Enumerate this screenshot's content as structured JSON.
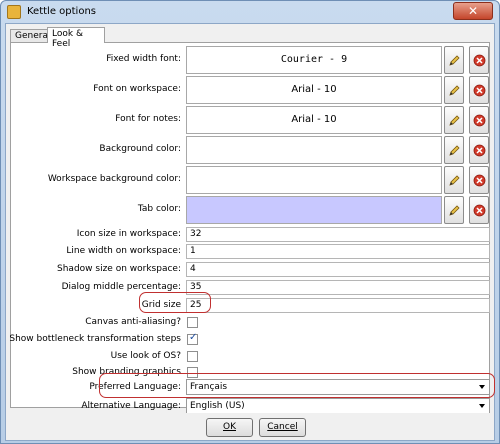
{
  "window": {
    "title": "Kettle options",
    "close_glyph": "✕"
  },
  "tabs": [
    {
      "label": "General",
      "active": false
    },
    {
      "label": "Look & Feel",
      "active": true
    }
  ],
  "fonts": {
    "fixed_width": {
      "label": "Fixed width font:",
      "value": "Courier - 9"
    },
    "workspace": {
      "label": "Font on workspace:",
      "value": "Arial - 10"
    },
    "notes": {
      "label": "Font for notes:",
      "value": "Arial - 10"
    }
  },
  "colors": {
    "background": {
      "label": "Background color:",
      "value": "#ffffff"
    },
    "workspace_background": {
      "label": "Workspace background color:",
      "value": "#ffffff"
    },
    "tab": {
      "label": "Tab color:",
      "value": "#c8c8ff"
    }
  },
  "fields": {
    "icon_size": {
      "label": "Icon size in workspace:",
      "value": "32"
    },
    "line_width": {
      "label": "Line width on workspace:",
      "value": "1"
    },
    "shadow_size": {
      "label": "Shadow size on workspace:",
      "value": "4"
    },
    "dialog_middle": {
      "label": "Dialog middle percentage:",
      "value": "35"
    },
    "grid_size": {
      "label": "Grid size",
      "value": "25"
    }
  },
  "checks": {
    "anti_aliasing": {
      "label": "Canvas anti-aliasing?",
      "checked": false
    },
    "bottleneck": {
      "label": "Show bottleneck transformation steps",
      "checked": true
    },
    "look_of_os": {
      "label": "Use look of OS?",
      "checked": false
    },
    "branding": {
      "label": "Show branding graphics",
      "checked": false
    }
  },
  "languages": {
    "preferred": {
      "label": "Preferred Language:",
      "value": "Français"
    },
    "alternative": {
      "label": "Alternative Language:",
      "value": "English (US)"
    }
  },
  "buttons": {
    "ok": "OK",
    "cancel": "Cancel"
  },
  "icons": {
    "edit": "pencil-icon",
    "clear": "clear-icon"
  },
  "accent": {
    "highlight": "#c03030",
    "clear_red": "#d23a2a"
  }
}
